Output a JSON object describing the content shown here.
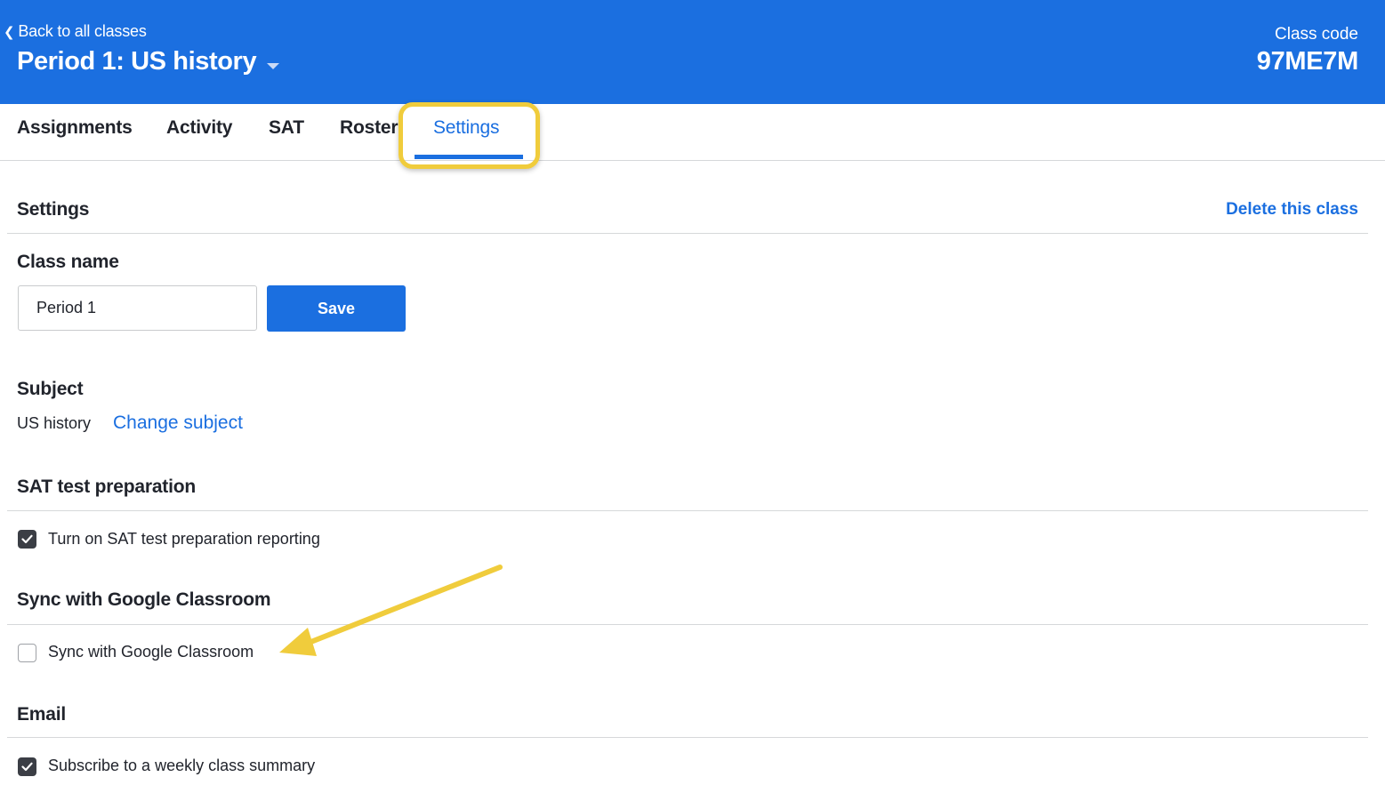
{
  "header": {
    "back_label": "Back to all classes",
    "class_title": "Period 1: US history",
    "class_code_label": "Class code",
    "class_code": "97ME7M"
  },
  "tabs": [
    {
      "label": "Assignments",
      "active": false
    },
    {
      "label": "Activity",
      "active": false
    },
    {
      "label": "SAT",
      "active": false
    },
    {
      "label": "Roster",
      "active": false
    },
    {
      "label": "Settings",
      "active": true
    }
  ],
  "settings": {
    "title": "Settings",
    "delete_label": "Delete this class",
    "class_name": {
      "label": "Class name",
      "value": "Period 1",
      "save_label": "Save"
    },
    "subject": {
      "label": "Subject",
      "value": "US history",
      "change_label": "Change subject"
    },
    "sat": {
      "title": "SAT test preparation",
      "checkbox_label": "Turn on SAT test preparation reporting",
      "checked": true
    },
    "google_sync": {
      "title": "Sync with Google Classroom",
      "checkbox_label": "Sync with Google Classroom",
      "checked": false
    },
    "email": {
      "title": "Email",
      "checkbox_label": "Subscribe to a weekly class summary",
      "checked": true
    }
  },
  "colors": {
    "brand_blue": "#1b6fe0",
    "highlight_yellow": "#f0cc3c",
    "checkbox_dark": "#3b3e45"
  },
  "icons": {
    "back": "chevron-left-icon",
    "title_dropdown": "caret-down-icon",
    "checked": "checkmark-icon",
    "annotation": "arrow-icon"
  }
}
